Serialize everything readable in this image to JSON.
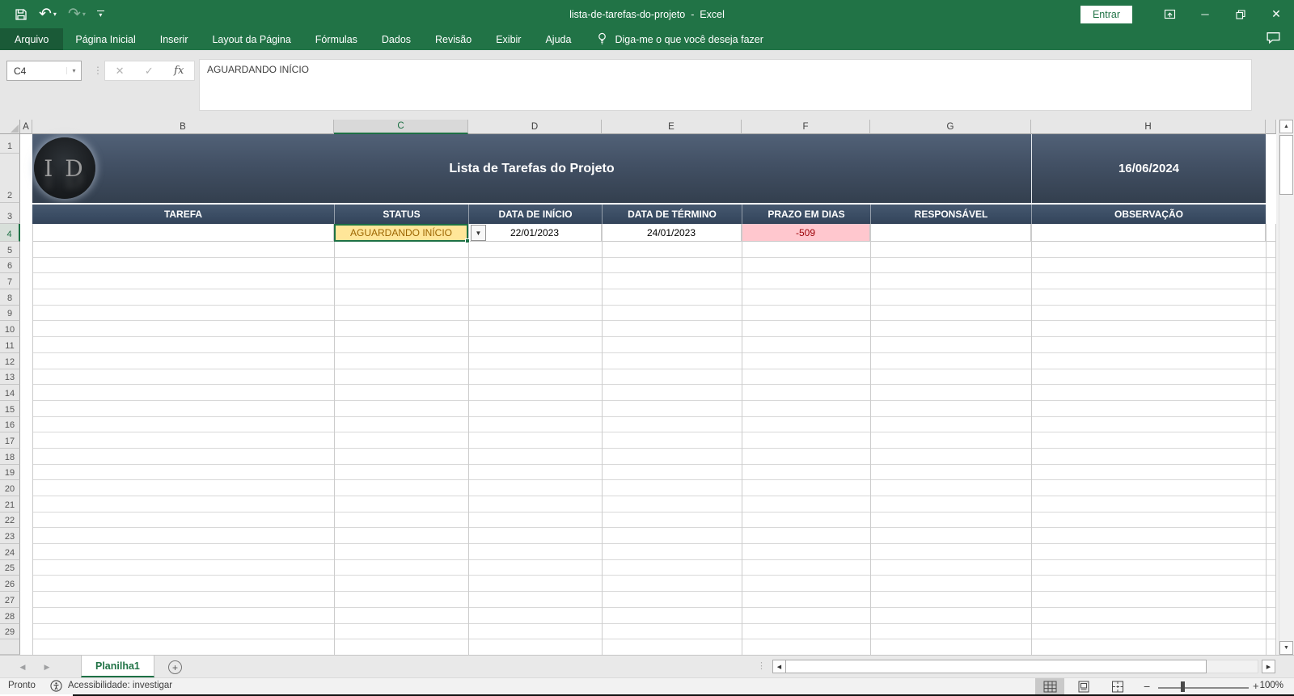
{
  "window": {
    "title": "lista-de-tarefas-do-projeto  -  Excel",
    "sign_in": "Entrar"
  },
  "ribbon": {
    "tabs": [
      "Arquivo",
      "Página Inicial",
      "Inserir",
      "Layout da Página",
      "Fórmulas",
      "Dados",
      "Revisão",
      "Exibir",
      "Ajuda"
    ],
    "active_tab": "Arquivo",
    "tell_me": "Diga-me o que você deseja fazer"
  },
  "formula_bar": {
    "name_box": "C4",
    "fx_label": "fx",
    "content": "AGUARDANDO INÍCIO"
  },
  "grid": {
    "columns": [
      "A",
      "B",
      "C",
      "D",
      "E",
      "F",
      "G",
      "H"
    ],
    "selected_column": "C",
    "visible_rows": 29,
    "selected_row": 4
  },
  "document": {
    "banner_title": "Lista de Tarefas do Projeto",
    "banner_date": "16/06/2024",
    "logo_text": "I D",
    "table_headers": [
      "TAREFA",
      "STATUS",
      "DATA DE INÍCIO",
      "DATA DE TÉRMINO",
      "PRAZO EM DIAS",
      "RESPONSÁVEL",
      "OBSERVAÇÃO"
    ],
    "row4": {
      "status": "AGUARDANDO INÍCIO",
      "data_inicio": "22/01/2023",
      "data_termino": "24/01/2023",
      "prazo_em_dias": "-509"
    }
  },
  "sheet_tabs": {
    "tabs": [
      "Planilha1"
    ],
    "active": "Planilha1"
  },
  "status_bar": {
    "mode": "Pronto",
    "accessibility": "Acessibilidade: investigar",
    "zoom": "100%"
  },
  "colors": {
    "excel_green": "#217346",
    "banner_top": "#516177",
    "banner_bottom": "#333F4E",
    "header_band": "#3B4D64",
    "status_fill": "#FFE699",
    "status_text": "#9C6500",
    "overdue_fill": "#FFC7CE",
    "overdue_text": "#9C0006",
    "selection_green": "#1E7145"
  }
}
